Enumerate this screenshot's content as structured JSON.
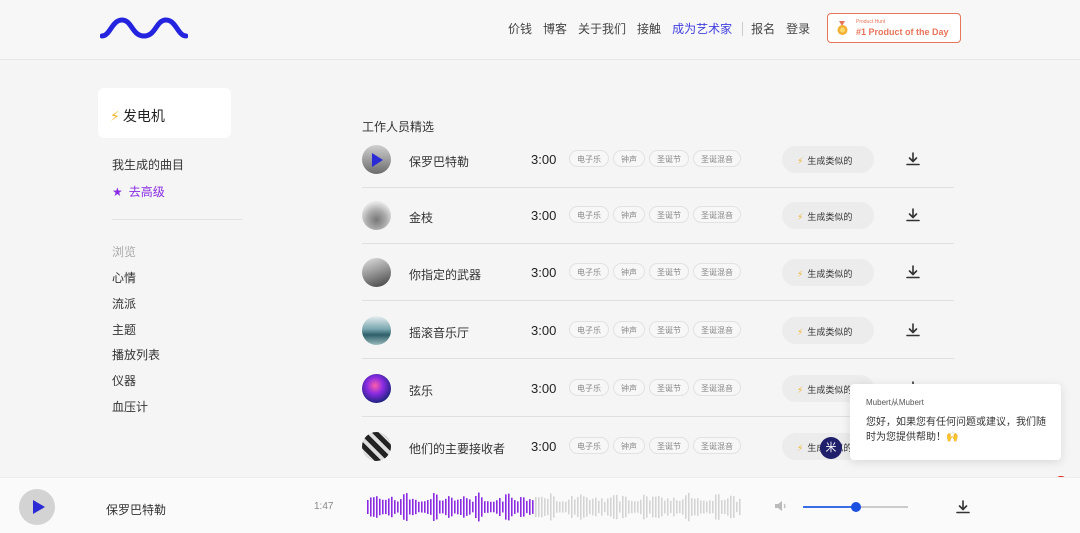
{
  "header": {
    "nav": [
      "价钱",
      "博客",
      "关于我们",
      "接触",
      "成为艺术家"
    ],
    "signup": "报名",
    "login": "登录",
    "ph_badge": {
      "small": "Product Hunt",
      "title": "#1 Product of the Day"
    }
  },
  "sidebar": {
    "generator": "发电机",
    "my_tracks": "我生成的曲目",
    "upgrade": "去高级",
    "browse_label": "浏览",
    "browse_items": [
      "心情",
      "流派",
      "主题",
      "播放列表",
      "仪器",
      "血压计"
    ]
  },
  "main": {
    "section_title": "工作人员精选",
    "similar_label": "生成类似的",
    "tracks": [
      {
        "name": "保罗巴特勒",
        "duration": "3:00",
        "tags": [
          "电子乐",
          "钟声",
          "圣诞节",
          "圣诞混音"
        ]
      },
      {
        "name": "金枝",
        "duration": "3:00",
        "tags": [
          "电子乐",
          "钟声",
          "圣诞节",
          "圣诞混音"
        ]
      },
      {
        "name": "你指定的武器",
        "duration": "3:00",
        "tags": [
          "电子乐",
          "钟声",
          "圣诞节",
          "圣诞混音"
        ]
      },
      {
        "name": "摇滚音乐厅",
        "duration": "3:00",
        "tags": [
          "电子乐",
          "钟声",
          "圣诞节",
          "圣诞混音"
        ]
      },
      {
        "name": "弦乐",
        "duration": "3:00",
        "tags": [
          "电子乐",
          "钟声",
          "圣诞节",
          "圣诞混音"
        ]
      },
      {
        "name": "他们的主要接收者",
        "duration": "3:00",
        "tags": [
          "电子乐",
          "钟声",
          "圣诞节",
          "圣诞混音"
        ]
      }
    ]
  },
  "chat": {
    "from": "Mubert从Mubert",
    "message": "您好，如果您有任何问题或建议，我们随时为您提供帮助！🙌",
    "avatar_initial": "米",
    "unread": "1"
  },
  "player": {
    "track": "保罗巴特勒",
    "elapsed": "1:47",
    "progress": 0.45,
    "volume": 0.5
  },
  "colors": {
    "accent": "#2b2bd6",
    "brand_blue": "#1b4fe0",
    "upgrade_purple": "#8a2be2",
    "wave_played": "#8a2be2",
    "ph_orange": "#e7755a"
  }
}
